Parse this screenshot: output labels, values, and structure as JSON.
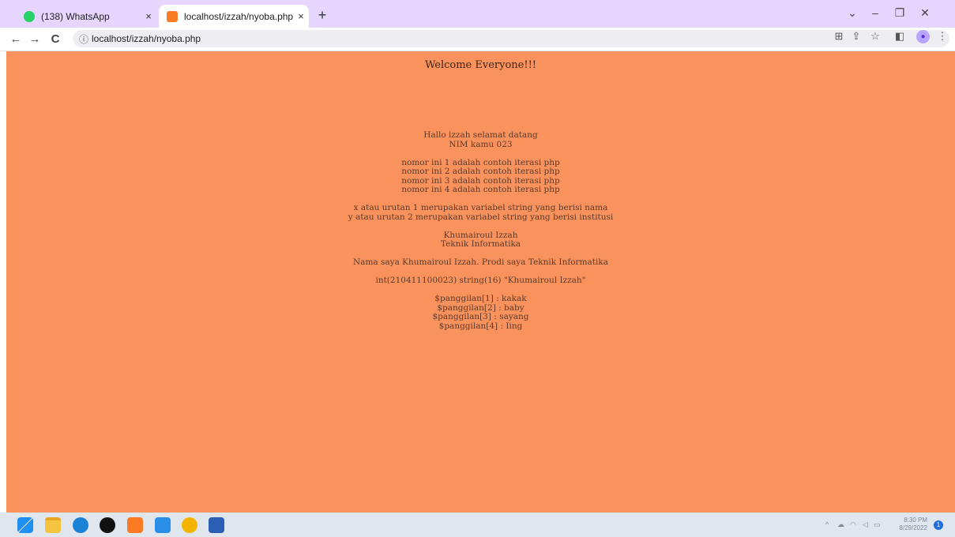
{
  "browser": {
    "tabs": [
      {
        "title": "(138) WhatsApp",
        "close": "×"
      },
      {
        "title": "localhost/izzah/nyoba.php",
        "close": "×"
      }
    ],
    "new_tab": "+",
    "window_controls": {
      "chevron": "⌄",
      "minimize": "–",
      "restore": "❐",
      "close": "✕"
    },
    "nav": {
      "back": "←",
      "forward": "→",
      "reload": "C"
    },
    "address": {
      "info_icon": "ⓘ",
      "url": "localhost/izzah/nyoba.php"
    },
    "toolbar_icons": {
      "translate": "⊞",
      "share": "⇪",
      "star": "☆",
      "sidepanel": "◧",
      "menu": "⋮"
    }
  },
  "page": {
    "heading": "Welcome Everyone!!!",
    "lines": {
      "greeting": "Hallo izzah selamat datang",
      "nim": "NIM kamu 023",
      "iter1": "nomor ini 1 adalah contoh iterasi php",
      "iter2": "nomor ini 2 adalah contoh iterasi php",
      "iter3": "nomor ini 3 adalah contoh iterasi php",
      "iter4": "nomor ini 4 adalah contoh iterasi php",
      "var_x": "x atau urutan 1 merupakan variabel string yang berisi nama",
      "var_y": "y atau urutan 2 merupakan variabel string yang berisi institusi",
      "name": "Khumairoul Izzah",
      "prodi": "Teknik Informatika",
      "sentence": "Nama saya Khumairoul Izzah. Prodi saya Teknik Informatika",
      "dump": "int(210411100023) string(16) \"Khumairoul Izzah\"",
      "call1": "$panggilan[1] : kakak",
      "call2": "$panggilan[2] : baby",
      "call3": "$panggilan[3] : sayang",
      "call4": "$panggilan[4] : Iing"
    },
    "background_color": "#f9925d"
  },
  "taskbar": {
    "apps": [
      "windows-start",
      "file-explorer",
      "edge",
      "tiktok",
      "xampp",
      "vscode",
      "chrome-canary",
      "word"
    ],
    "tray": {
      "chevron": "^",
      "time": "8:30 PM",
      "date": "8/29/2022",
      "notifications": "1"
    }
  }
}
